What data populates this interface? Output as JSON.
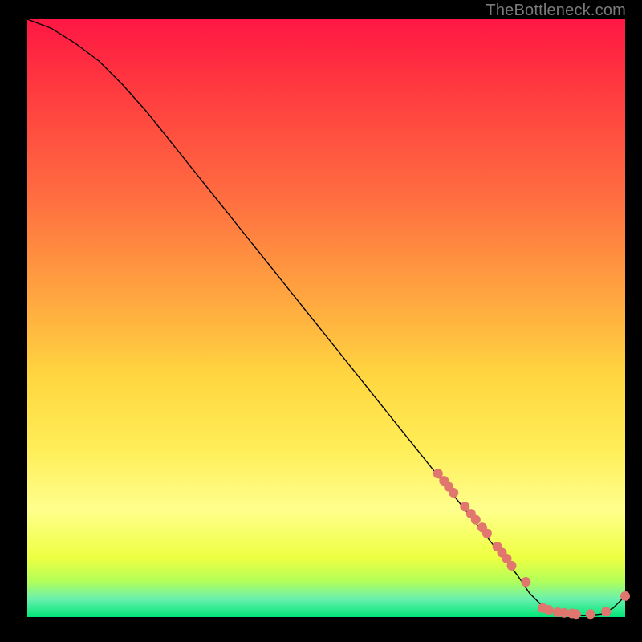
{
  "attribution": "TheBottleneck.com",
  "chart_data": {
    "type": "line",
    "title": "",
    "xlabel": "",
    "ylabel": "",
    "xlim": [
      0,
      100
    ],
    "ylim": [
      0,
      100
    ],
    "series": [
      {
        "name": "curve",
        "x": [
          0,
          4,
          8,
          12,
          16,
          20,
          24,
          28,
          32,
          36,
          40,
          44,
          48,
          52,
          56,
          60,
          64,
          68,
          72,
          76,
          80,
          82,
          84,
          86,
          88,
          90,
          92,
          94,
          96,
          98,
          100
        ],
        "y": [
          100,
          98.5,
          96,
          93,
          89,
          84.5,
          79.5,
          74.5,
          69.5,
          64.5,
          59.5,
          54.5,
          49.5,
          44.5,
          39.5,
          34.5,
          29.5,
          24.5,
          19.5,
          14.5,
          9.5,
          7.0,
          4.0,
          2.0,
          0.8,
          0.4,
          0.3,
          0.3,
          0.5,
          1.5,
          3.5
        ]
      }
    ],
    "markers": {
      "name": "dots",
      "color": "#e0766e",
      "radius_px": 6,
      "points": [
        {
          "x": 68.7,
          "y": 24.0
        },
        {
          "x": 69.7,
          "y": 22.8
        },
        {
          "x": 70.5,
          "y": 21.8
        },
        {
          "x": 71.3,
          "y": 20.8
        },
        {
          "x": 73.2,
          "y": 18.5
        },
        {
          "x": 74.2,
          "y": 17.3
        },
        {
          "x": 75.0,
          "y": 16.3
        },
        {
          "x": 76.1,
          "y": 15.0
        },
        {
          "x": 76.9,
          "y": 14.0
        },
        {
          "x": 78.6,
          "y": 11.8
        },
        {
          "x": 79.4,
          "y": 10.8
        },
        {
          "x": 80.2,
          "y": 9.8
        },
        {
          "x": 81.0,
          "y": 8.6
        },
        {
          "x": 83.4,
          "y": 5.9
        },
        {
          "x": 86.2,
          "y": 1.5
        },
        {
          "x": 87.2,
          "y": 1.2
        },
        {
          "x": 88.7,
          "y": 0.8
        },
        {
          "x": 89.8,
          "y": 0.7
        },
        {
          "x": 91.1,
          "y": 0.6
        },
        {
          "x": 91.8,
          "y": 0.5
        },
        {
          "x": 94.2,
          "y": 0.5
        },
        {
          "x": 96.8,
          "y": 0.9
        },
        {
          "x": 100.0,
          "y": 3.5
        }
      ]
    }
  }
}
